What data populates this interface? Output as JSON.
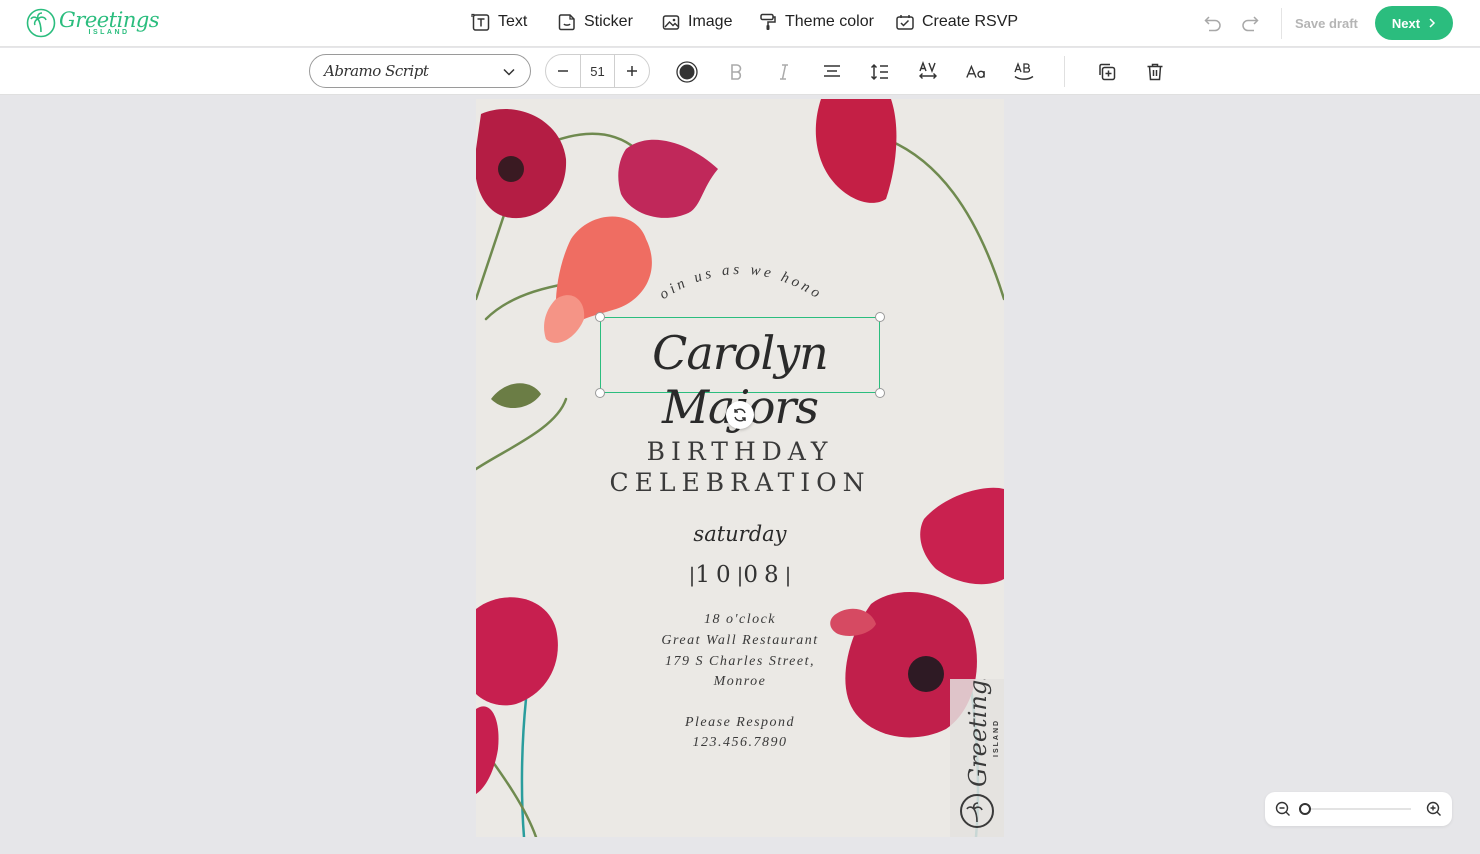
{
  "app": {
    "logo_word": "Greetings",
    "logo_sub": "ISLAND"
  },
  "topbar": {
    "tools": [
      {
        "label": "Text",
        "icon": "text-icon"
      },
      {
        "label": "Sticker",
        "icon": "sticker-icon"
      },
      {
        "label": "Image",
        "icon": "image-icon"
      },
      {
        "label": "Theme color",
        "icon": "paint-roller-icon"
      },
      {
        "label": "Create RSVP",
        "icon": "rsvp-icon"
      }
    ],
    "save_draft": "Save draft",
    "next": "Next"
  },
  "format_toolbar": {
    "font_name": "Abramo Script",
    "font_size": "51",
    "icons": [
      "color-swatch-icon",
      "bold-icon",
      "italic-icon",
      "align-center-icon",
      "line-height-icon",
      "letter-spacing-icon",
      "text-case-icon",
      "uppercase-icon",
      "duplicate-icon",
      "delete-icon"
    ]
  },
  "card": {
    "arc_line": "Join us as we honor",
    "name": "Carolyn Majors",
    "event_line_1": "BIRTHDAY",
    "event_line_2": "CELEBRATION",
    "day": "saturday",
    "date_month": "10",
    "date_day": "08",
    "details": [
      "18 o'clock",
      "Great Wall Restaurant",
      "179 S Charles Street,",
      "Monroe"
    ],
    "respond": [
      "Please Respond",
      "123.456.7890"
    ],
    "watermark_word": "Greetings",
    "watermark_sub": "ISLAND"
  },
  "zoom": {
    "level_fraction": 0
  },
  "colors": {
    "accent": "#2bbd7e",
    "canvas_bg": "#e6e6e9",
    "card_bg": "#ebe9e5",
    "poppy": "#c8234f",
    "poppy_light": "#ee6a64"
  }
}
